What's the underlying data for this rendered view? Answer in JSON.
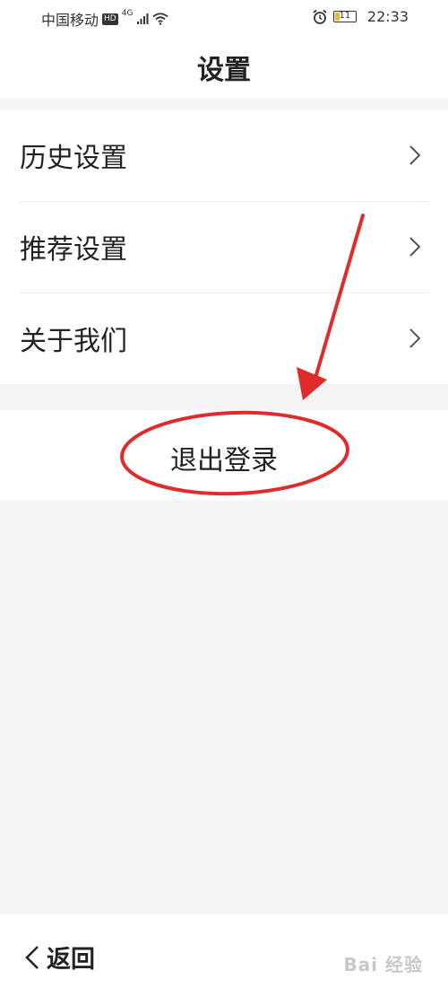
{
  "status_bar": {
    "carrier": "中国移动",
    "hd_badge": "HD",
    "network": "4G",
    "battery": "11",
    "time": "22:33"
  },
  "header": {
    "title": "设置"
  },
  "menu": {
    "items": [
      {
        "label": "历史设置",
        "icon": "chevron-right-icon"
      },
      {
        "label": "推荐设置",
        "icon": "chevron-right-icon"
      },
      {
        "label": "关于我们",
        "icon": "chevron-right-icon"
      }
    ]
  },
  "logout": {
    "label": "退出登录"
  },
  "annotation": {
    "color": "#e02b2b"
  },
  "bottom_bar": {
    "back_label": "返回",
    "back_icon": "chevron-left-icon"
  },
  "watermark": {
    "text": "Bai 经验"
  }
}
